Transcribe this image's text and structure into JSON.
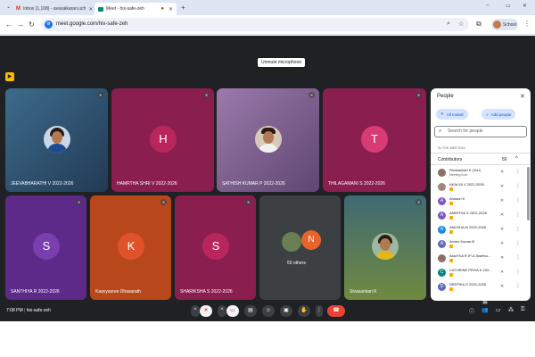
{
  "browser": {
    "tabs": [
      {
        "title": "Inbox (1,108) - avasaikaran.uch",
        "favicon": "gmail-icon",
        "active": false
      },
      {
        "title": "Meet - hix-safe-zeh",
        "favicon": "meet-icon",
        "active": true
      }
    ],
    "url": "meet.google.com/hix-safe-zeh",
    "profile_label": "School",
    "window_controls": [
      "–",
      "▭",
      "✕"
    ]
  },
  "tooltip": "Unmute microphone",
  "tiles": [
    {
      "name": "JEEVABHARATHI V 2022-2026",
      "type": "photo",
      "bg": "#2f4f73"
    },
    {
      "name": "HAMRTHA SHRI V 2022-2026",
      "type": "letter",
      "letter": "H",
      "bg": "#8a1e4f",
      "avatar": "#b8265d"
    },
    {
      "name": "SATHISH KUMAR P 2022-2026",
      "type": "photo",
      "bg": "#7c5b8c"
    },
    {
      "name": "THILAGAMANI S 2022-2026",
      "type": "letter",
      "letter": "T",
      "bg": "#8a1e4f",
      "avatar": "#d63b74"
    },
    {
      "name": "SANTHIYA R 2022-2026",
      "type": "letter",
      "letter": "S",
      "bg": "#5d2a8a",
      "avatar": "#7a3fae"
    },
    {
      "name": "Kaavyasree Dhasarath",
      "type": "letter",
      "letter": "K",
      "bg": "#b8481c",
      "avatar": "#e0532a"
    },
    {
      "name": "SHARIKSHA S 2022-2026",
      "type": "letter",
      "letter": "S",
      "bg": "#8a1e4f",
      "avatar": "#b8265d"
    },
    {
      "name": "50 others",
      "type": "others",
      "letter": "N",
      "bg": "#3c4043"
    },
    {
      "name": "Sivasankari K",
      "type": "photo",
      "bg": "#4b6a6d"
    }
  ],
  "panel": {
    "title": "People",
    "all_muted": "All muted",
    "add_people": "Add people",
    "search_placeholder": "Search for people",
    "section": "IN THE MEETING",
    "contributors_label": "Contributors",
    "contributors_count": "59",
    "people": [
      {
        "name": "Sivasankari K (You)",
        "sub": "Meeting host",
        "color": "#8d6e63",
        "letter": ""
      },
      {
        "name": "AKALYA V 2022-2026",
        "sub": "",
        "color": "#a1887f",
        "letter": ""
      },
      {
        "name": "Anusuri K",
        "sub": "",
        "color": "#7e57c2",
        "letter": "A"
      },
      {
        "name": "AMRITHA S 2022-2026",
        "sub": "",
        "color": "#7e57c2",
        "letter": "A"
      },
      {
        "name": "ANUSHA M 2022-2026",
        "sub": "",
        "color": "#1e88e5",
        "letter": "A"
      },
      {
        "name": "Arvinn Kumar B",
        "sub": "",
        "color": "#5c6bc0",
        "letter": "A"
      },
      {
        "name": "AswIThA R IP-A Swethu...",
        "sub": "",
        "color": "#8d6e63",
        "letter": ""
      },
      {
        "name": "CATHRINE PRIYA K 202...",
        "sub": "",
        "color": "#00897b",
        "letter": "C"
      },
      {
        "name": "DEEPIKA S 2022-2026",
        "sub": "",
        "color": "#5c6bc0",
        "letter": "D"
      }
    ]
  },
  "bottom": {
    "time": "7:08 PM",
    "code": "hix-safe-zeh",
    "people_count": "59"
  },
  "colors": {
    "background": "#202124",
    "accent_blue": "#1a73e8",
    "leave_red": "#ea4335"
  }
}
